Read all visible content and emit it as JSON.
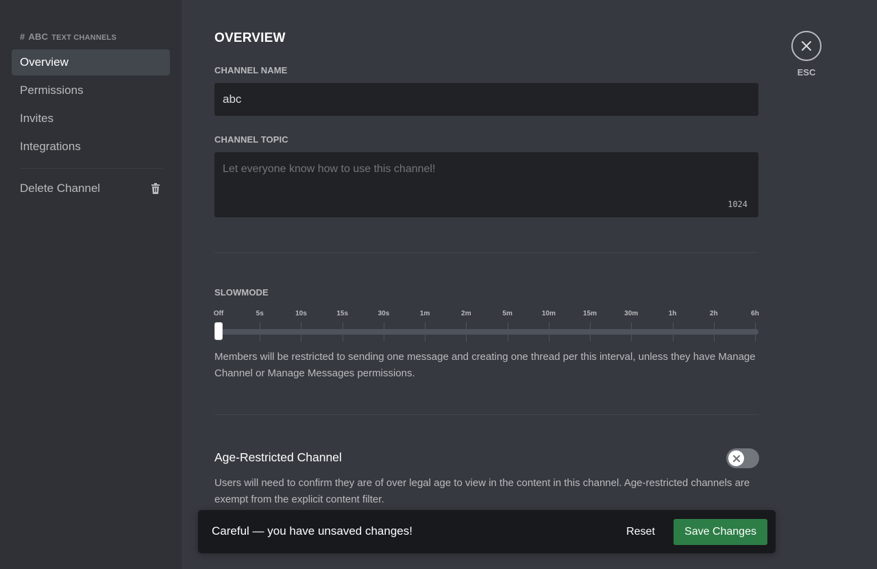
{
  "sidebar": {
    "header_hash": "#",
    "header_channel": "ABC",
    "header_sub": "TEXT CHANNELS",
    "items": [
      {
        "label": "Overview"
      },
      {
        "label": "Permissions"
      },
      {
        "label": "Invites"
      },
      {
        "label": "Integrations"
      }
    ],
    "delete_label": "Delete Channel"
  },
  "main": {
    "title": "OVERVIEW",
    "channel_name_label": "CHANNEL NAME",
    "channel_name_value": "abc",
    "channel_topic_label": "CHANNEL TOPIC",
    "channel_topic_placeholder": "Let everyone know how to use this channel!",
    "channel_topic_remaining": "1024",
    "slowmode_label": "SLOWMODE",
    "slowmode_ticks": [
      "Off",
      "5s",
      "10s",
      "15s",
      "30s",
      "1m",
      "2m",
      "5m",
      "10m",
      "15m",
      "30m",
      "1h",
      "2h",
      "6h"
    ],
    "slowmode_selected_index": 0,
    "slowmode_desc": "Members will be restricted to sending one message and creating one thread per this interval, unless they have Manage Channel or Manage Messages permissions.",
    "age_restricted_title": "Age-Restricted Channel",
    "age_restricted_enabled": false,
    "age_restricted_desc": "Users will need to confirm they are of over legal age to view in the content in this channel. Age-restricted channels are exempt from the explicit content filter."
  },
  "esc": {
    "label": "ESC"
  },
  "notice": {
    "text": "Careful — you have unsaved changes!",
    "reset_label": "Reset",
    "save_label": "Save Changes"
  },
  "colors": {
    "save_green": "#2d7d46",
    "background": "#36393f",
    "sidebar": "#2f3136",
    "input": "#202225"
  },
  "icons": {
    "close": "close-icon",
    "trash": "trash-icon",
    "toggle_off": "x-icon"
  }
}
